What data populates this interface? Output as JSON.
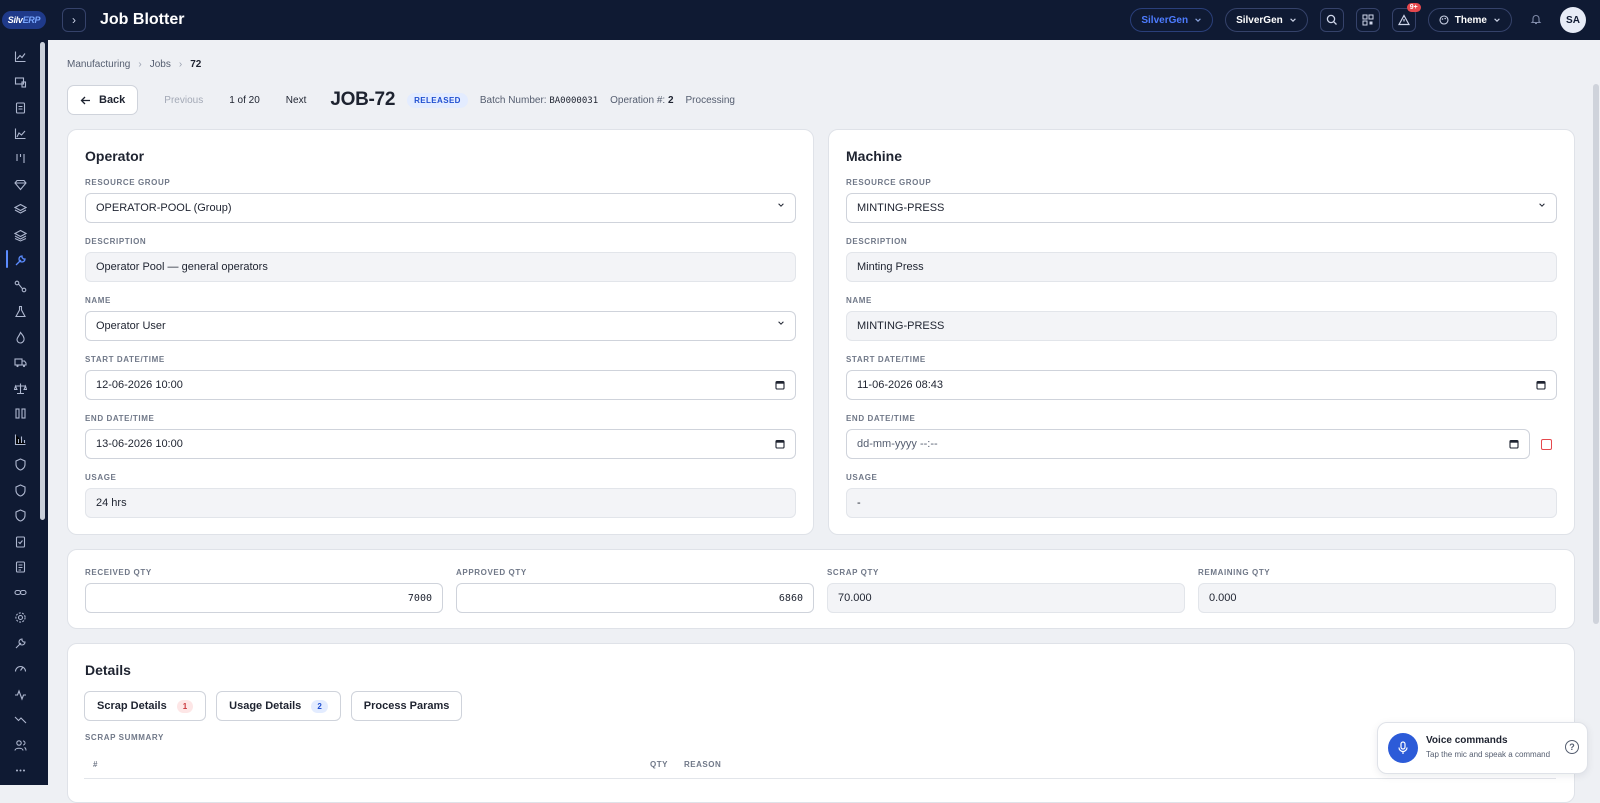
{
  "app": {
    "logo_text_a": "Silv",
    "logo_text_b": "ERP",
    "title": "Job Blotter"
  },
  "topbar": {
    "company_switch": "SilverGen",
    "workspace_switch": "SilverGen",
    "notifications_badge": "9+",
    "theme_label": "Theme",
    "user_initials": "SA"
  },
  "breadcrumb": {
    "items": [
      "Manufacturing",
      "Jobs",
      "72"
    ]
  },
  "header": {
    "back_label": "Back",
    "previous_label": "Previous",
    "position": "1 of 20",
    "next_label": "Next",
    "job_id": "JOB-72",
    "status": "RELEASED",
    "batch_label": "Batch Number:",
    "batch_value": "BA0000031",
    "operation_label": "Operation #:",
    "operation_value": "2",
    "phase": "Processing"
  },
  "operator": {
    "title": "Operator",
    "resource_group_label": "RESOURCE GROUP",
    "resource_group_value": "OPERATOR-POOL (Group)",
    "description_label": "DESCRIPTION",
    "description_value": "Operator Pool — general operators",
    "name_label": "NAME",
    "name_value": "Operator User",
    "start_label": "START DATE/TIME",
    "start_value": "12-06-2026 10:00",
    "end_label": "END DATE/TIME",
    "end_value": "13-06-2026 10:00",
    "usage_label": "USAGE",
    "usage_value": "24 hrs"
  },
  "machine": {
    "title": "Machine",
    "resource_group_label": "RESOURCE GROUP",
    "resource_group_value": "MINTING-PRESS",
    "description_label": "DESCRIPTION",
    "description_value": "Minting Press",
    "name_label": "NAME",
    "name_value": "MINTING-PRESS",
    "start_label": "START DATE/TIME",
    "start_value": "11-06-2026 08:43",
    "end_label": "END DATE/TIME",
    "end_placeholder": "dd-mm-yyyy --:--",
    "usage_label": "USAGE",
    "usage_value": "-"
  },
  "quantities": {
    "received_label": "RECEIVED QTY",
    "received_value": "7000",
    "approved_label": "APPROVED QTY",
    "approved_value": "6860",
    "scrap_label": "SCRAP QTY",
    "scrap_value": "70.000",
    "remaining_label": "REMAINING QTY",
    "remaining_value": "0.000"
  },
  "details": {
    "title": "Details",
    "tabs": [
      {
        "label": "Scrap Details",
        "count": "1"
      },
      {
        "label": "Usage Details",
        "count": "2"
      },
      {
        "label": "Process Params"
      }
    ],
    "summary_label": "SCRAP SUMMARY",
    "columns": [
      "#",
      "QTY",
      "REASON"
    ]
  },
  "voice": {
    "title": "Voice commands",
    "subtitle": "Tap the mic and speak a command"
  },
  "colors": {
    "topbar_bg": "#0f1a33",
    "accent": "#2c5bd8",
    "status_badge_bg": "#e3ecff",
    "danger": "#e5484d"
  }
}
